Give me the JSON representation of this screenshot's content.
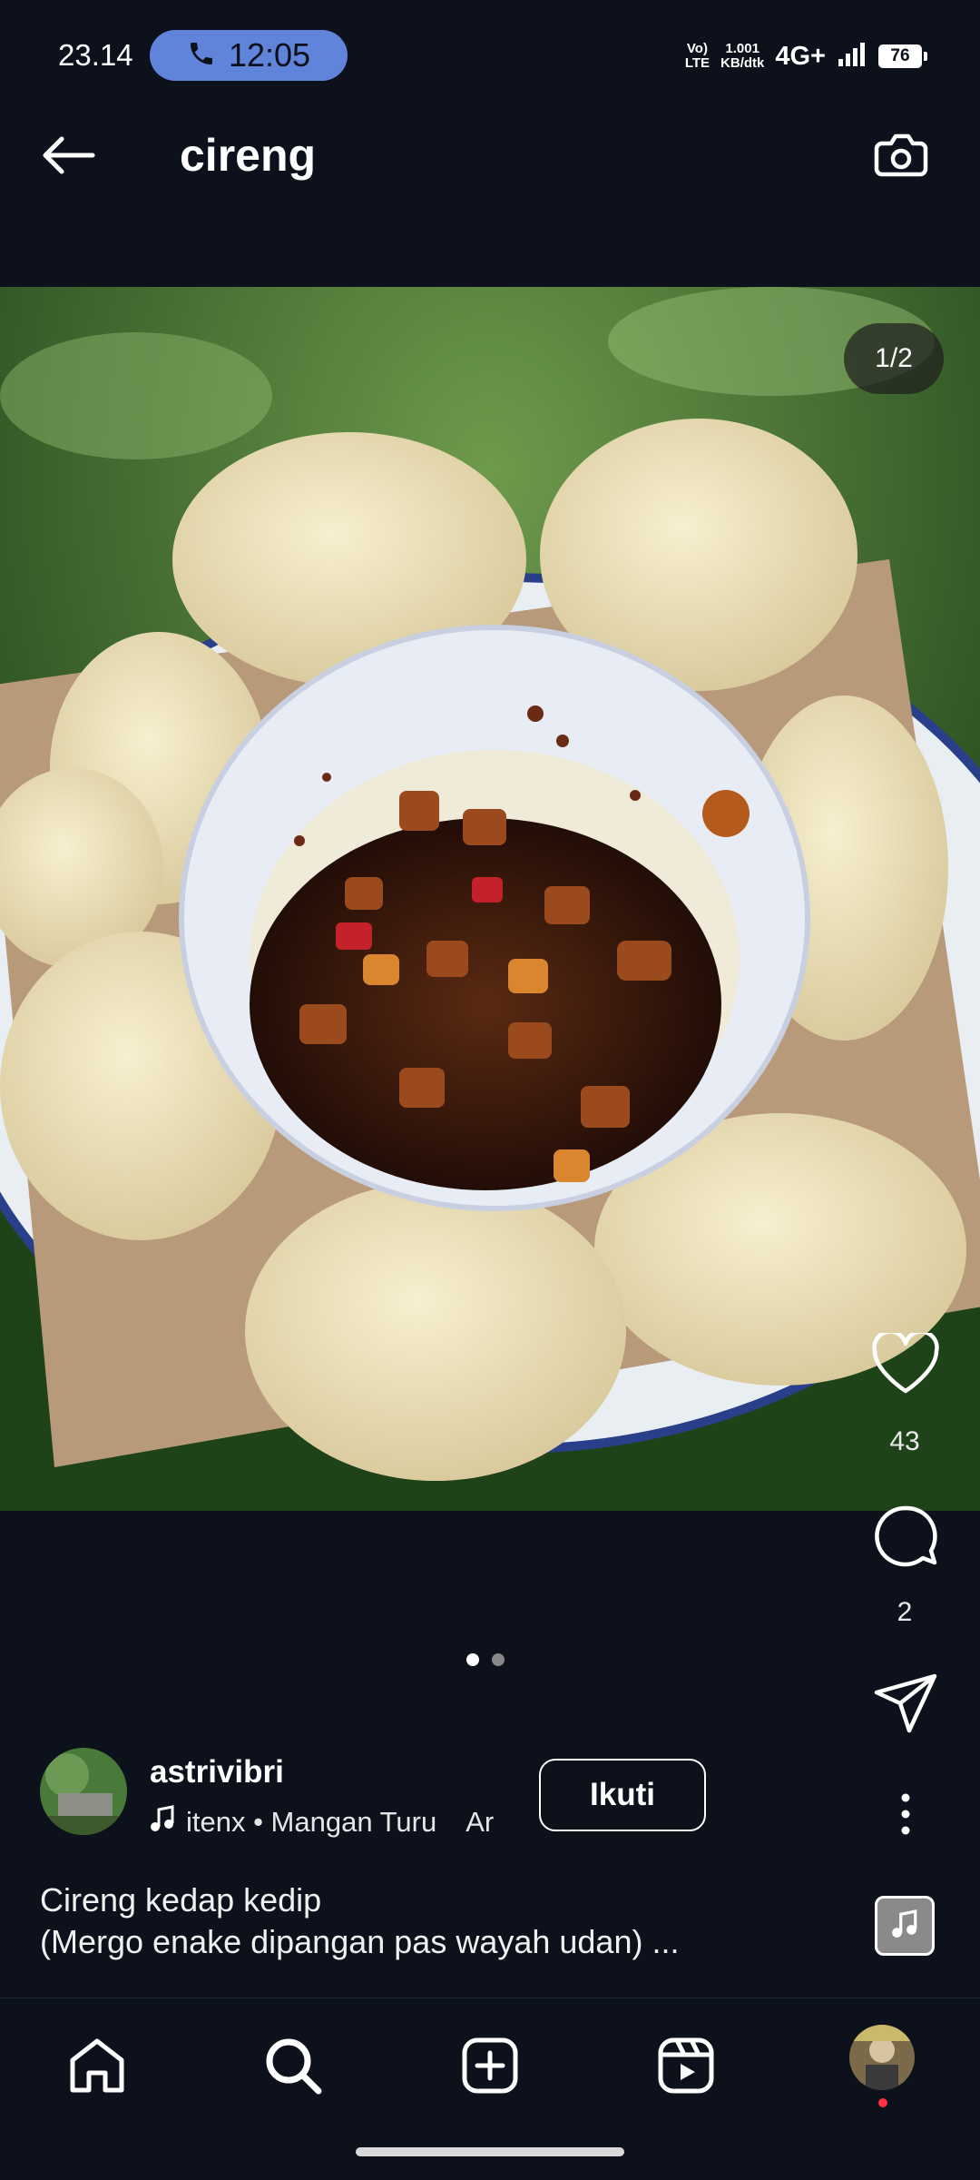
{
  "status_bar": {
    "time": "23.14",
    "call_timer": "12:05",
    "volte": "Vo) LTE",
    "speed_value": "1.001",
    "speed_unit": "KB/dtk",
    "network": "4G+",
    "battery": "76"
  },
  "header": {
    "title": "cireng",
    "back_icon": "arrow-left-icon",
    "camera_icon": "camera-icon"
  },
  "post": {
    "image_counter": "1/2",
    "image_total": 2,
    "image_index": 1,
    "likes": "43",
    "comments": "2",
    "username": "astrivibri",
    "music": "itenx • Mangan Turu",
    "music_overflow": "Ar",
    "follow_label": "Ikuti",
    "caption_line1": "Cireng kedap kedip",
    "caption_line2": "(Mergo enake dipangan pas wayah udan) ..."
  },
  "nav": {
    "items": [
      "home-icon",
      "search-icon",
      "add-post-icon",
      "reels-icon",
      "profile-avatar"
    ]
  },
  "colors": {
    "background": "#0c111b",
    "call_pill": "#5f84d9",
    "notification": "#ff3040"
  }
}
